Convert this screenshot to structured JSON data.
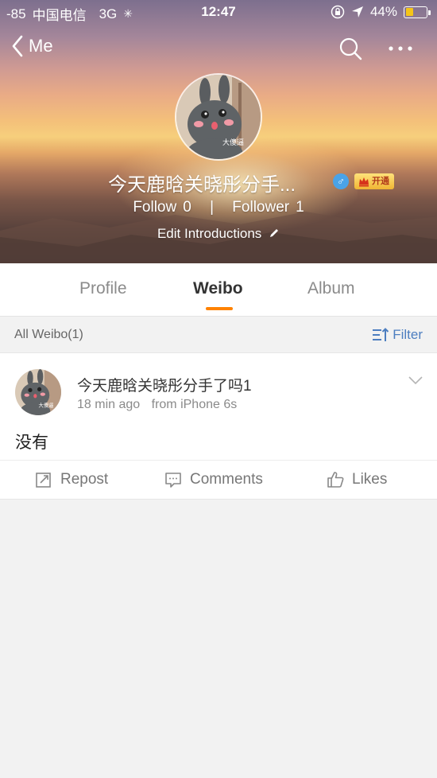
{
  "status_bar": {
    "signal": "-85",
    "carrier": "中国电信",
    "network": "3G",
    "time": "12:47",
    "battery_percent": "44%",
    "battery_level": 0.44
  },
  "nav": {
    "back_label": "Me",
    "search_icon": "search-icon",
    "more_icon": "more-icon"
  },
  "profile": {
    "avatar_caption": "大傻逼",
    "username": "今天鹿晗关晓彤分手...",
    "gender": "♂",
    "vip_label": "开通",
    "follow_label": "Follow",
    "follow_count": "0",
    "separator": "|",
    "follower_label": "Follower",
    "follower_count": "1",
    "edit_label": "Edit Introductions"
  },
  "tabs": [
    {
      "label": "Profile",
      "active": false
    },
    {
      "label": "Weibo",
      "active": true
    },
    {
      "label": "Album",
      "active": false
    }
  ],
  "filter_bar": {
    "all_label": "All Weibo(1)",
    "filter_label": "Filter"
  },
  "post": {
    "author": "今天鹿晗关晓彤分手了吗1",
    "time": "18 min ago",
    "source": "from iPhone 6s",
    "content": "没有",
    "avatar_caption": "大傻逼",
    "actions": {
      "repost": "Repost",
      "comments": "Comments",
      "likes": "Likes"
    }
  },
  "colors": {
    "accent": "#ff8200",
    "link": "#4d7ec0",
    "background": "#f2f2f2"
  }
}
